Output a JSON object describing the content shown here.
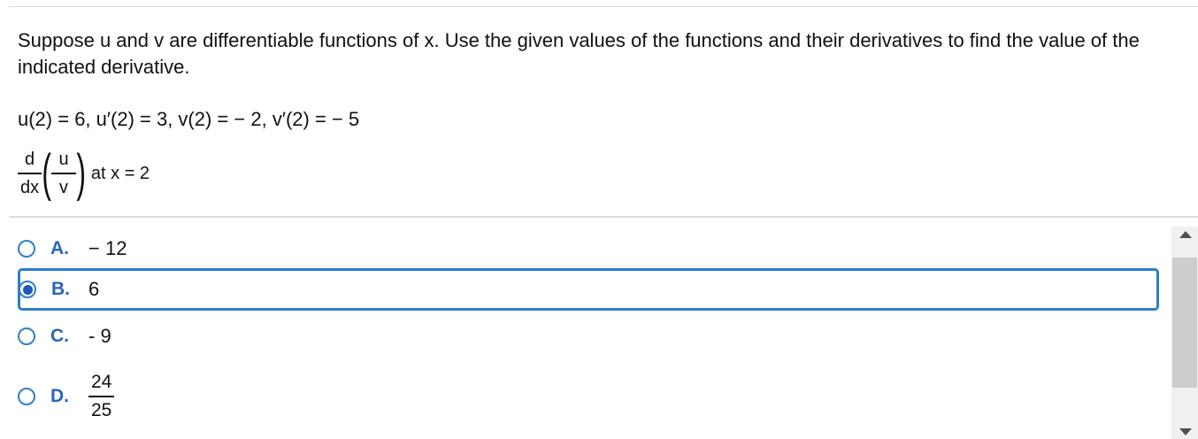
{
  "question": {
    "text": "Suppose u and v are differentiable functions of x. Use the given values of the functions and their derivatives to find the value of the indicated derivative."
  },
  "given": {
    "text": "u(2) = 6, u′(2) = 3, v(2) = − 2, v′(2) = − 5"
  },
  "expression": {
    "d_numerator": "d",
    "d_denominator": "dx",
    "u": "u",
    "v": "v",
    "at": "at x = 2"
  },
  "choices": [
    {
      "letter": "A.",
      "value": "− 12",
      "selected": false
    },
    {
      "letter": "B.",
      "value": "6",
      "selected": true
    },
    {
      "letter": "C.",
      "value": "- 9",
      "selected": false
    },
    {
      "letter": "D.",
      "numerator": "24",
      "denominator": "25",
      "selected": false
    }
  ],
  "colors": {
    "accent": "#2a7fcb",
    "letter": "#2a66b8"
  }
}
